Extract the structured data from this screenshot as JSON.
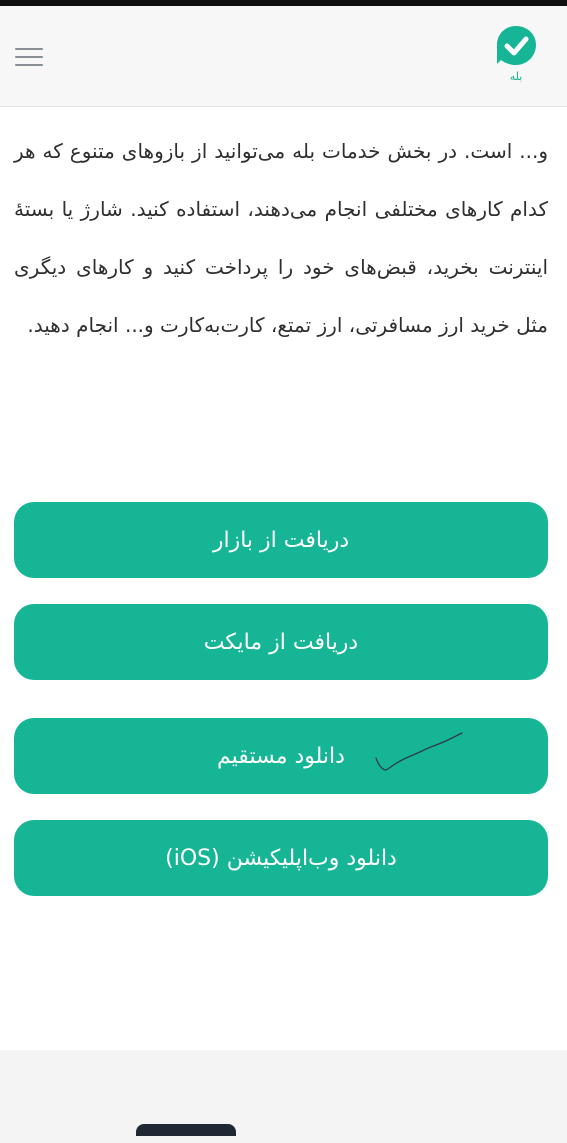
{
  "header": {
    "logo_text": "بله",
    "brand_color": "#16b596"
  },
  "content": {
    "paragraph": "و... است. در بخش خدمات بله می‌توانید از بازوهای متنوع که هر کدام کارهای مختلفی انجام می‌دهند، استفاده کنید. شارژ یا بستهٔ اینترنت بخرید، قبض‌های خود را پرداخت کنید و کارهای دیگری مثل خرید ارز مسافرتی، ارز تمتع، کارت‌به‌کارت و... انجام دهید."
  },
  "buttons": {
    "bazaar": "دریافت از بازار",
    "myket": "دریافت از مایکت",
    "direct": "دانلود مستقیم",
    "webapp": "دانلود وب‌اپلیکیشن (iOS)"
  },
  "icons": {
    "menu": "hamburger-menu-icon",
    "logo": "bale-checkmark-logo-icon"
  }
}
